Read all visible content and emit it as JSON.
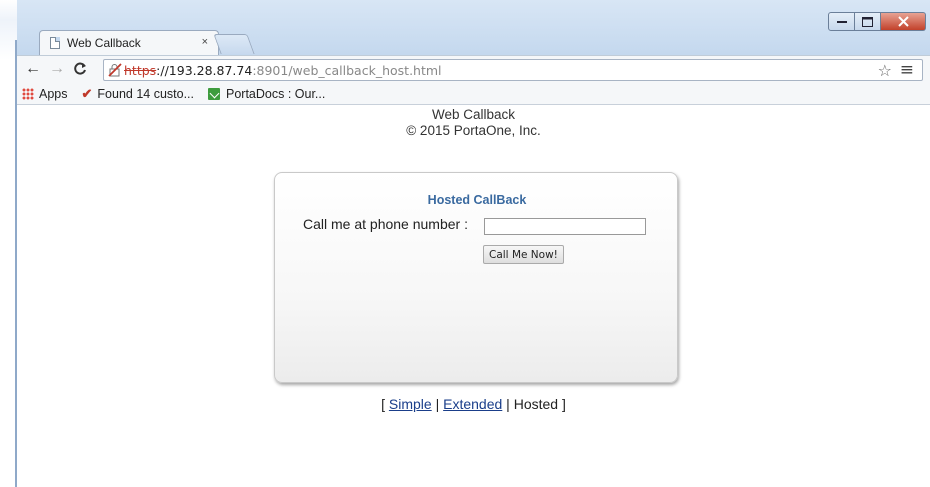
{
  "browser": {
    "tab_title": "Web Callback",
    "tab_close": "×",
    "url_scheme": "https",
    "url_host": "://193.28.87.74",
    "url_rest": ":8901/web_callback_host.html",
    "bookmarks": [
      {
        "label": "Apps",
        "icon": "apps-grid-icon"
      },
      {
        "label": "Found 14 custo...",
        "icon": "checkmark-icon"
      },
      {
        "label": "PortaDocs : Our...",
        "icon": "portadocs-icon"
      }
    ]
  },
  "page": {
    "title": "Web Callback",
    "copyright": "© 2015 PortaOne, Inc.",
    "card": {
      "title": "Hosted CallBack",
      "phone_label": "Call me at phone number :",
      "phone_value": "",
      "button_label": "Call Me Now!"
    },
    "modes": {
      "open": "[ ",
      "simple": "Simple",
      "sep1": " | ",
      "extended": "Extended",
      "sep2": " | ",
      "hosted": "Hosted",
      "close": " ]"
    }
  },
  "colors": {
    "card_title": "#3a6aa0",
    "link": "#1a3e8a",
    "url_scheme_error": "#c0392b"
  }
}
